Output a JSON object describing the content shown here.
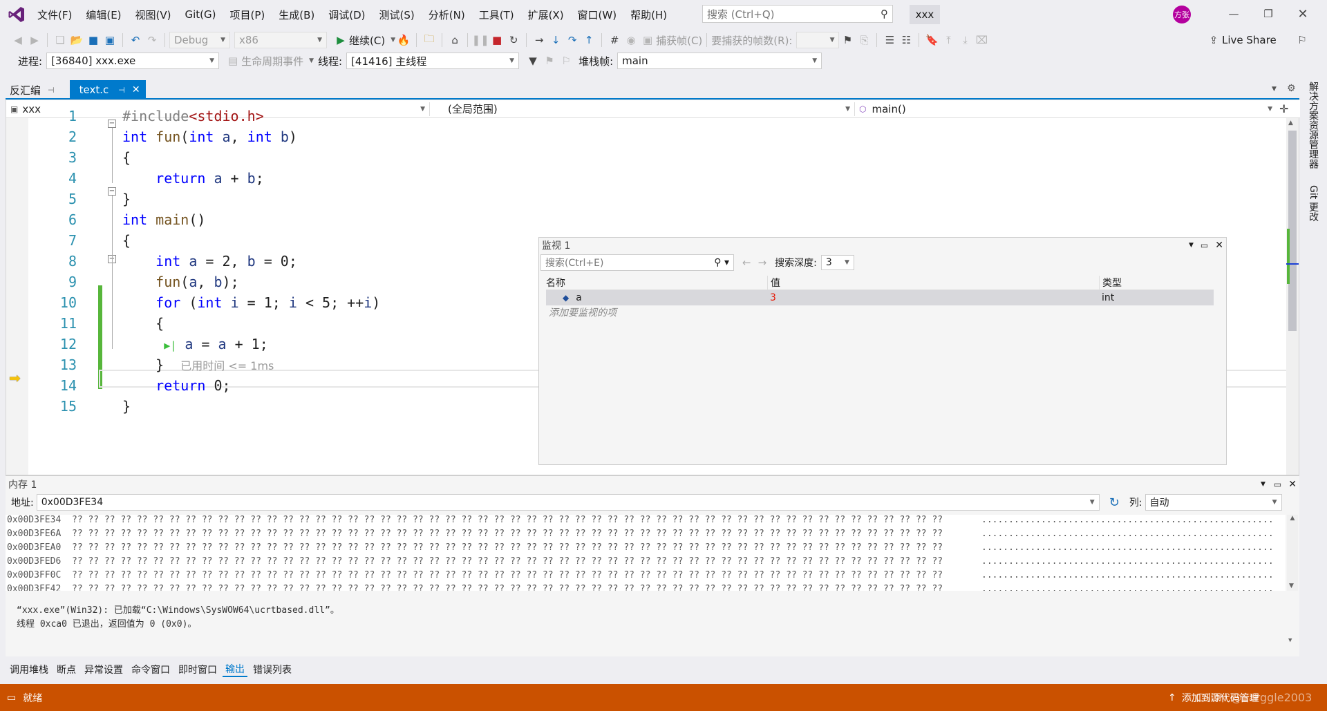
{
  "title": {
    "menus": [
      "文件(F)",
      "编辑(E)",
      "视图(V)",
      "Git(G)",
      "项目(P)",
      "生成(B)",
      "调试(D)",
      "测试(S)",
      "分析(N)",
      "工具(T)",
      "扩展(X)",
      "窗口(W)",
      "帮助(H)"
    ],
    "search_placeholder": "搜索 (Ctrl+Q)",
    "solution": "xxx",
    "avatar": "方张"
  },
  "toolbar": {
    "config": "Debug",
    "platform": "x86",
    "continue": "继续(C)",
    "capture_frame": "捕获帧(C)",
    "frames_label": "要捕获的帧数(R):",
    "live_share": "Live Share"
  },
  "debug_location": {
    "process_label": "进程:",
    "process": "[36840] xxx.exe",
    "lifecycle": "生命周期事件",
    "thread_label": "线程:",
    "thread": "[41416] 主线程",
    "stack_label": "堆栈帧:",
    "stack": "main"
  },
  "tabs": {
    "disasm": "反汇编",
    "file": "text.c"
  },
  "navbar": {
    "project": "xxx",
    "scope": "(全局范围)",
    "member": "main()"
  },
  "code": {
    "line_numbers": [
      "1",
      "2",
      "3",
      "4",
      "5",
      "6",
      "7",
      "8",
      "9",
      "10",
      "11",
      "12",
      "13",
      "14",
      "15"
    ],
    "perf_tip": "已用时间 <= 1ms"
  },
  "side_tabs": {
    "solution": "解决方案资源管理器",
    "git": "Git 更改"
  },
  "watch": {
    "title": "监视 1",
    "search_placeholder": "搜索(Ctrl+E)",
    "depth_label": "搜索深度:",
    "depth": "3",
    "columns": [
      "名称",
      "值",
      "类型"
    ],
    "rows": [
      {
        "name": "a",
        "value": "3",
        "type": "int"
      }
    ],
    "add_hint": "添加要监视的项"
  },
  "memory": {
    "title": "内存 1",
    "address_label": "地址:",
    "address": "0x00D3FE34",
    "columns_label": "列:",
    "columns_value": "自动",
    "addresses": [
      "0x00D3FE34",
      "0x00D3FE6A",
      "0x00D3FEA0",
      "0x00D3FED6",
      "0x00D3FF0C",
      "0x00D3FF42"
    ],
    "bytes": "?? ?? ?? ?? ?? ?? ?? ?? ?? ?? ?? ?? ?? ?? ?? ?? ?? ?? ?? ?? ?? ?? ?? ?? ?? ?? ?? ?? ?? ?? ?? ?? ?? ?? ?? ?? ?? ?? ?? ?? ?? ?? ?? ?? ?? ?? ?? ?? ?? ?? ?? ?? ?? ??",
    "ascii": "......................................................"
  },
  "output": {
    "lines": [
      "“xxx.exe”(Win32): 已加载“C:\\Windows\\SysWOW64\\ucrtbased.dll”。",
      "线程 0xca0 已退出，返回值为 0 (0x0)。"
    ]
  },
  "bottom_tabs": [
    "调用堆栈",
    "断点",
    "异常设置",
    "命令窗口",
    "即时窗口",
    "输出",
    "错误列表"
  ],
  "status": {
    "ready": "就绪",
    "source_control": "添加到源代码管理",
    "watermark": "CSDN @Sarggle2003"
  },
  "colors": {
    "accent": "#007acc",
    "status": "#ca5100",
    "breakpoint_green": "#3bbe3b"
  }
}
